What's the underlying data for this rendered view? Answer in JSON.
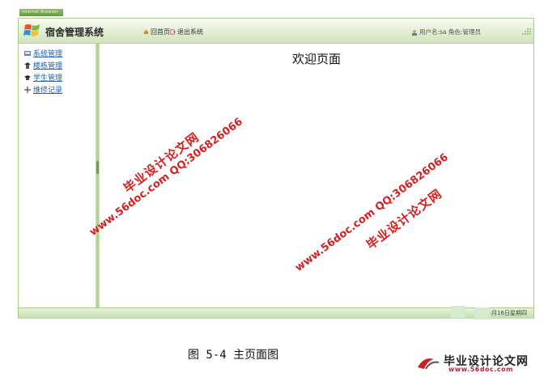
{
  "tiny_badge": "Internet Browser",
  "header": {
    "title": "宿舍管理系统",
    "nav": [
      {
        "label": "回首页",
        "icon": "home-icon"
      },
      {
        "label": "退出系统",
        "icon": "exit-icon"
      }
    ],
    "user_info": "用户名:sa 角色:管理员"
  },
  "sidebar": {
    "items": [
      {
        "label": "系统管理",
        "icon": "system-icon"
      },
      {
        "label": "楼栋管理",
        "icon": "building-icon"
      },
      {
        "label": "学生管理",
        "icon": "student-icon"
      },
      {
        "label": "维修记录",
        "icon": "repair-icon"
      }
    ]
  },
  "main": {
    "welcome": "欢迎页面"
  },
  "footer": {
    "date": "5月16日星期四"
  },
  "watermarks": [
    {
      "line1": "毕业设计论文网",
      "line2": "www.56doc.com  QQ:306826066"
    },
    {
      "line1": "毕业设计论文网",
      "line2": "www.56doc.com  QQ:306826066"
    }
  ],
  "caption": "图 5-4 主页面图",
  "stamp": {
    "name": "毕业设计论文网",
    "url": "www.56doc.com"
  },
  "colors": {
    "accent_green": "#a8c98a",
    "link_blue": "#1f5fb3",
    "watermark_red": "#d61f1f"
  }
}
